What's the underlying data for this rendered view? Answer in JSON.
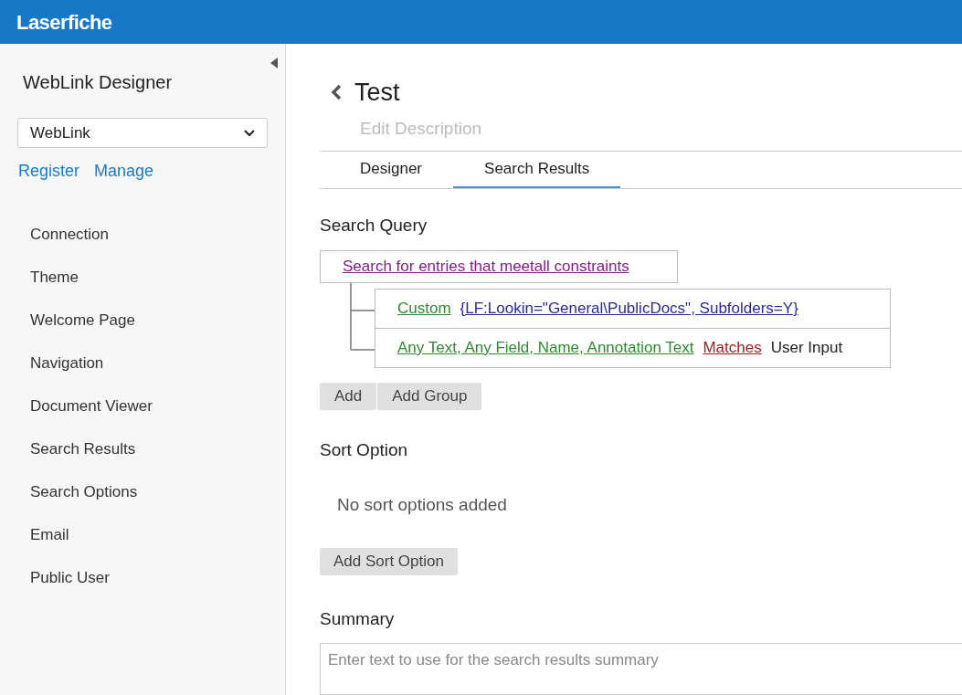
{
  "header": {
    "logo": "Laserfiche"
  },
  "sidebar": {
    "title": "WebLink Designer",
    "site_select": {
      "value": "WebLink"
    },
    "links": [
      "Register",
      "Manage"
    ],
    "items": [
      {
        "label": "Connection",
        "selected": false
      },
      {
        "label": "Theme",
        "selected": false
      },
      {
        "label": "Welcome Page",
        "selected": false
      },
      {
        "label": "Navigation",
        "selected": false
      },
      {
        "label": "Document Viewer",
        "selected": false
      },
      {
        "label": "Search Results",
        "selected": false
      },
      {
        "label": "Search Options",
        "selected": false
      },
      {
        "label": "Email",
        "selected": false
      },
      {
        "label": "Public User",
        "selected": false
      }
    ]
  },
  "page": {
    "title": "Test",
    "description_placeholder": "Edit Description"
  },
  "tabs": [
    {
      "label": "Designer",
      "selected": false
    },
    {
      "label": "Search Results",
      "selected": true
    }
  ],
  "search_query": {
    "heading": "Search Query",
    "root": "Search for entries that meetall constraints",
    "conditions": [
      {
        "parts": [
          {
            "kind": "field",
            "text": "Custom"
          },
          {
            "kind": "value-link",
            "text": "{LF:Lookin=\"General\\PublicDocs\", Subfolders=Y}"
          }
        ]
      },
      {
        "parts": [
          {
            "kind": "field",
            "text": "Any Text, Any Field, Name, Annotation Text"
          },
          {
            "kind": "operator",
            "text": "Matches"
          },
          {
            "kind": "value-text",
            "text": "User Input"
          }
        ]
      }
    ],
    "buttons": [
      "Add",
      "Add Group"
    ]
  },
  "sort_option": {
    "heading": "Sort Option",
    "empty_text": "No sort options added",
    "button": "Add Sort Option"
  },
  "summary": {
    "heading": "Summary",
    "placeholder": "Enter text to use for the search results summary"
  }
}
